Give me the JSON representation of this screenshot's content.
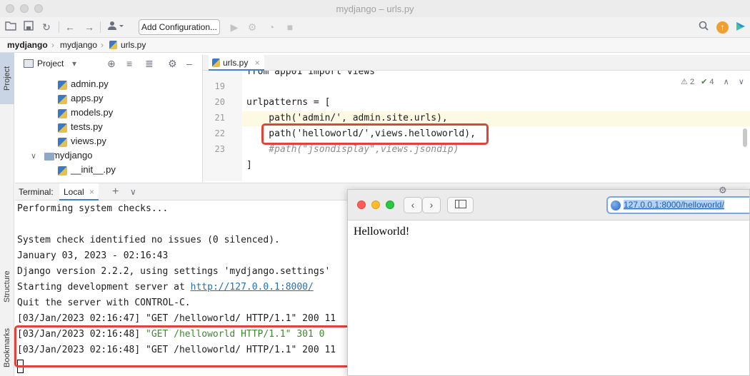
{
  "window": {
    "title": "mydjango – urls.py"
  },
  "toolbar": {
    "config_button": "Add Configuration...",
    "icons": [
      "folder-open-icon",
      "save-icon",
      "sync-icon",
      "back-icon",
      "forward-icon",
      "user-icon",
      "run-icon",
      "debug-icon",
      "coverage-icon",
      "stop-icon",
      "search-icon",
      "update-icon",
      "jetbrains-icon"
    ]
  },
  "breadcrumb": {
    "items": [
      "mydjango",
      "mydjango",
      "urls.py"
    ]
  },
  "stripe": {
    "tabs": [
      "Project",
      "Structure",
      "Bookmarks"
    ]
  },
  "project": {
    "header": "Project",
    "tree": [
      {
        "name": "admin.py",
        "type": "py"
      },
      {
        "name": "apps.py",
        "type": "py"
      },
      {
        "name": "models.py",
        "type": "py"
      },
      {
        "name": "tests.py",
        "type": "py"
      },
      {
        "name": "views.py",
        "type": "py"
      },
      {
        "name": "mydjango",
        "type": "folder"
      },
      {
        "name": "__init__.py",
        "type": "py"
      }
    ]
  },
  "editor": {
    "tab": "urls.py",
    "inspections": {
      "warnings": "2",
      "ok": "4"
    },
    "lines": [
      {
        "num": "19",
        "text": ""
      },
      {
        "num": "20",
        "text": "urlpatterns = ["
      },
      {
        "num": "21",
        "text": "    path('admin/', admin.site.urls),"
      },
      {
        "num": "22",
        "text": "    path('helloworld/',views.helloworld),"
      },
      {
        "num": "23",
        "text": "    #path(\"jsondisplay\",views.jsondip)"
      }
    ],
    "partial_top": "from app01 import views"
  },
  "terminal": {
    "label": "Terminal:",
    "tab": "Local",
    "lines": [
      "Performing system checks...",
      "",
      "System check identified no issues (0 silenced).",
      "January 03, 2023 - 02:16:43",
      "Django version 2.2.2, using settings 'mydjango.settings'",
      "Starting development server at ",
      "Quit the server with CONTROL-C.",
      "[03/Jan/2023 02:16:47] \"GET /helloworld/ HTTP/1.1\" 200 11",
      "[03/Jan/2023 02:16:48] ",
      "[03/Jan/2023 02:16:48] \"GET /helloworld/ HTTP/1.1\" 200 11"
    ],
    "server_url": "http://127.0.0.1:8000/",
    "redirect_text": "\"GET /helloworld HTTP/1.1\" 301 0"
  },
  "browser": {
    "url": "127.0.0.1:8000/helloworld/",
    "content": "Helloworld!"
  },
  "colors": {
    "highlight": "#e0433c",
    "accent": "#4083c9"
  }
}
